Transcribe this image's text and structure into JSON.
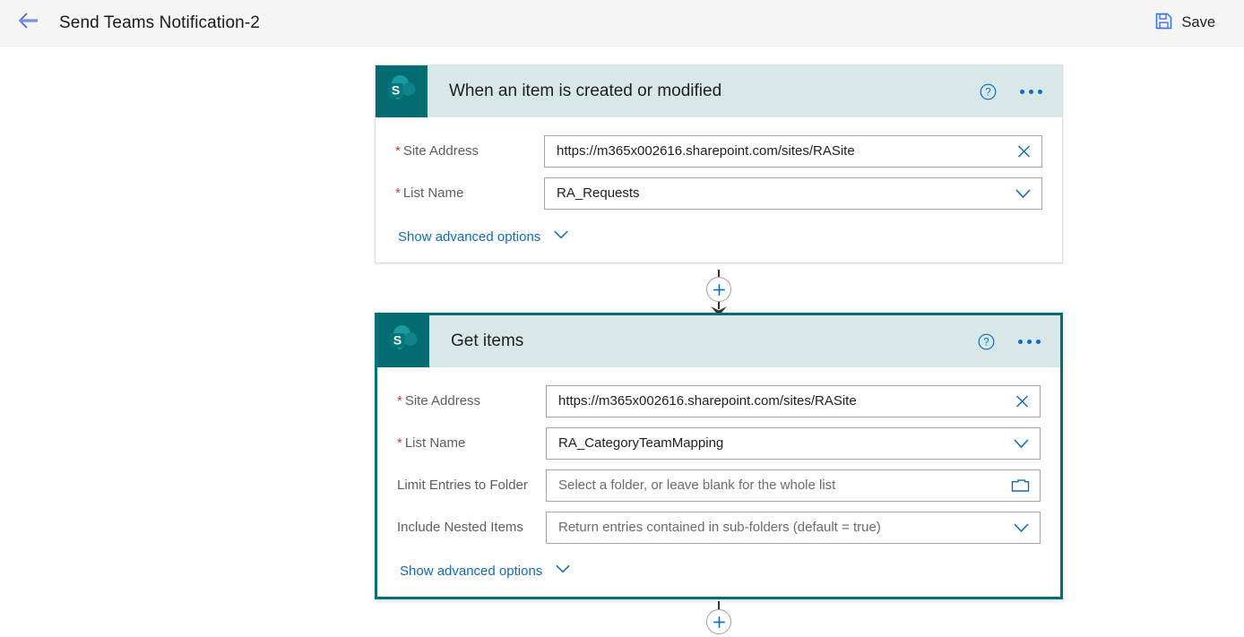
{
  "topbar": {
    "back_icon": "arrow-left-icon",
    "title": "Send Teams Notification-2",
    "save_icon": "save-floppy-icon",
    "save_label": "Save"
  },
  "colors": {
    "accent_blue": "#0f6cbd",
    "sharepoint_teal": "#036c70",
    "card_header_bg": "#d8e8e8",
    "selected_border": "#017075",
    "required_red": "#d13438",
    "topbar_bg": "#f5f5f5"
  },
  "cards": [
    {
      "id": "trigger-when-item-created-or-modified",
      "title": "When an item is created or modified",
      "connector_icon": "sharepoint-icon",
      "selected": false,
      "help_icon": "help-circle-icon",
      "more_icon": "more-horizontal-icon",
      "fields": [
        {
          "label": "Site Address",
          "required": true,
          "value": "https://m365x002616.sharepoint.com/sites/RASite",
          "is_placeholder": false,
          "icon": "clear-x-icon"
        },
        {
          "label": "List Name",
          "required": true,
          "value": "RA_Requests",
          "is_placeholder": false,
          "icon": "chevron-down-icon"
        }
      ],
      "advanced_options_label": "Show advanced options",
      "advanced_options_icon": "chevron-down-icon"
    },
    {
      "id": "action-get-items",
      "title": "Get items",
      "connector_icon": "sharepoint-icon",
      "selected": true,
      "help_icon": "help-circle-icon",
      "more_icon": "more-horizontal-icon",
      "fields": [
        {
          "label": "Site Address",
          "required": true,
          "value": "https://m365x002616.sharepoint.com/sites/RASite",
          "is_placeholder": false,
          "icon": "clear-x-icon"
        },
        {
          "label": "List Name",
          "required": true,
          "value": "RA_CategoryTeamMapping",
          "is_placeholder": false,
          "icon": "chevron-down-icon"
        },
        {
          "label": "Limit Entries to Folder",
          "required": false,
          "value": "Select a folder, or leave blank for the whole list",
          "is_placeholder": true,
          "icon": "folder-icon"
        },
        {
          "label": "Include Nested Items",
          "required": false,
          "value": "Return entries contained in sub-folders (default = true)",
          "is_placeholder": true,
          "icon": "chevron-down-icon"
        }
      ],
      "advanced_options_label": "Show advanced options",
      "advanced_options_icon": "chevron-down-icon"
    }
  ],
  "connectors": [
    {
      "id": "connector-after-trigger",
      "plus_icon": "add-step-plus-icon",
      "has_arrow": true
    },
    {
      "id": "connector-after-get-items",
      "plus_icon": "add-step-plus-icon",
      "has_arrow": false
    }
  ]
}
